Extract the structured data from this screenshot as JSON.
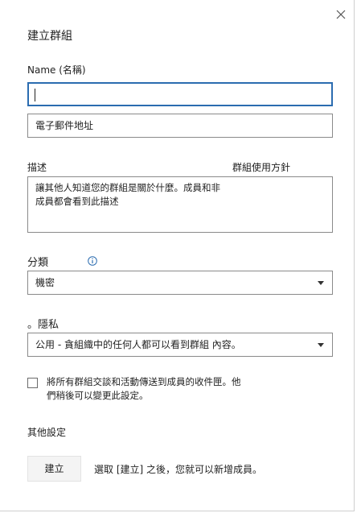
{
  "dialog": {
    "title": "建立群組"
  },
  "name_field": {
    "label": "Name (名稱)",
    "value": ""
  },
  "email_field": {
    "value": "電子郵件地址"
  },
  "description": {
    "label": "描述",
    "policy_link": "群組使用方針",
    "text": "讓其他人知道您的群組是關於什麼。成員和非\n成員都會看到此描述"
  },
  "classification": {
    "label": "分類",
    "selected": "機密"
  },
  "privacy": {
    "label": "。隱私",
    "selected": "公用 - 貪組織中的任何人都可以看到群組 內容。"
  },
  "subscribe": {
    "line1": "將所有群組交談和活動傳送到成員的收件匣。他",
    "line2": "們稍後可以變更此設定。"
  },
  "other_settings": {
    "label": "其他設定"
  },
  "footer": {
    "create_label": "建立",
    "hint": "選取 [建立] 之後，您就可以新增成員。"
  }
}
